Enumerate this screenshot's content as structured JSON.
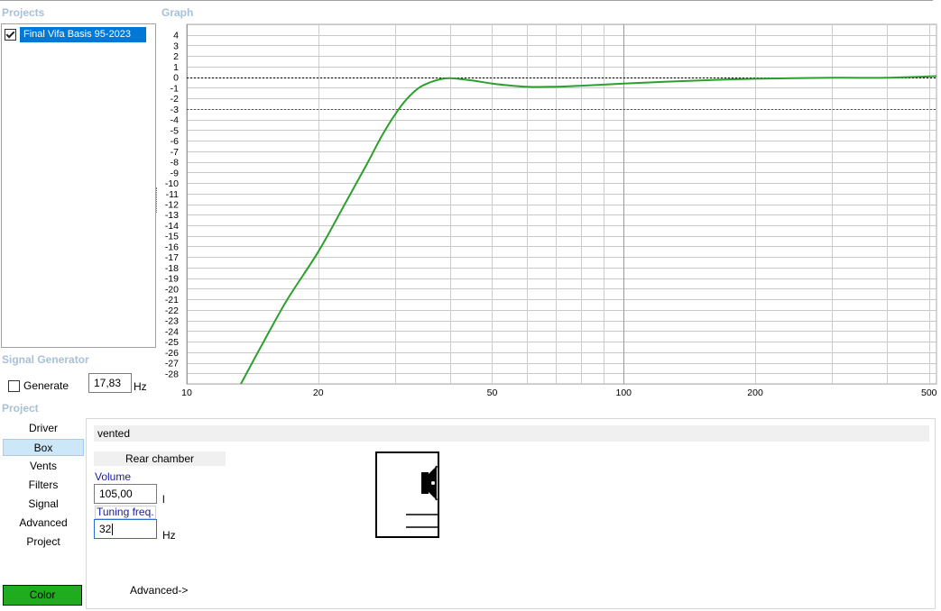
{
  "projects": {
    "title": "Projects",
    "items": [
      {
        "label": "Final Vifa Basis 95-2023",
        "checked": true
      }
    ]
  },
  "graph": {
    "title": "Graph"
  },
  "signal_generator": {
    "title": "Signal Generator",
    "generate_label": "Generate",
    "generate_checked": false,
    "frequency_value": "17,83",
    "frequency_unit": "Hz"
  },
  "project_section": {
    "title": "Project",
    "nav_items": [
      "Driver",
      "Box",
      "Vents",
      "Filters",
      "Signal",
      "Advanced",
      "Project"
    ],
    "active_item": "Box",
    "color_button": "Color"
  },
  "box": {
    "type_value": "vented",
    "chamber_header": "Rear chamber",
    "volume_label": "Volume",
    "volume_value": "105,00",
    "volume_unit": "l",
    "tuning_label": "Tuning freq.",
    "tuning_value": "32",
    "tuning_unit": "Hz",
    "advanced_link": "Advanced->"
  },
  "colors": {
    "curve": "#2ca02c",
    "selection": "#0078d7",
    "section_title": "#a8c0d8",
    "color_button": "#1fad1f",
    "active_nav": "#cce8f8"
  },
  "chart_data": {
    "type": "line",
    "x_scale": "log",
    "xlim": [
      10,
      520
    ],
    "ylim": [
      -29,
      5
    ],
    "x_ticks": [
      10,
      20,
      50,
      100,
      200,
      500
    ],
    "y_ticks": [
      4,
      3,
      2,
      1,
      0,
      -1,
      -2,
      -3,
      -4,
      -5,
      -6,
      -7,
      -8,
      -9,
      -10,
      -11,
      -12,
      -13,
      -14,
      -15,
      -16,
      -17,
      -18,
      -19,
      -20,
      -21,
      -22,
      -23,
      -24,
      -25,
      -26,
      -27,
      -28
    ],
    "reference_lines": [
      0,
      -3
    ],
    "grid": true,
    "series": [
      {
        "x": [
          13.3,
          15,
          17,
          20,
          23,
          26,
          28,
          30,
          32,
          34,
          36,
          38,
          40,
          45,
          50,
          60,
          70,
          80,
          100,
          150,
          200,
          300,
          400,
          520
        ],
        "y": [
          -29,
          -25,
          -21,
          -16.5,
          -12,
          -8,
          -5.5,
          -3.5,
          -2,
          -1,
          -0.5,
          -0.2,
          -0.1,
          -0.3,
          -0.6,
          -0.9,
          -0.9,
          -0.8,
          -0.6,
          -0.3,
          -0.15,
          -0.05,
          -0.05,
          0.1
        ]
      }
    ]
  }
}
